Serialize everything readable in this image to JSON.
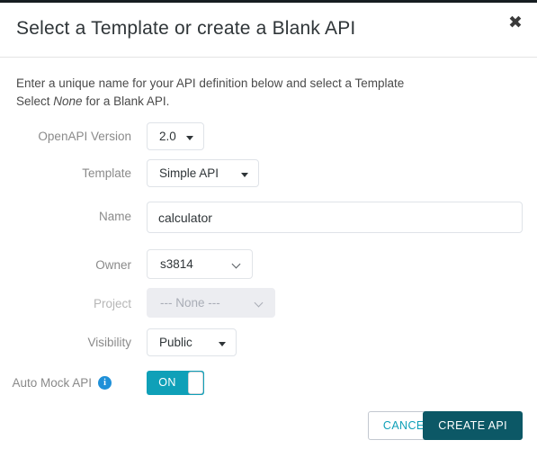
{
  "dialog": {
    "title": "Select a Template or create a Blank API",
    "close_icon": "close-icon",
    "intro_line1_before": "Enter a unique name for your API definition below and select a Template",
    "intro_line2_before": "Select ",
    "intro_italic": "None",
    "intro_line2_after": " for a Blank API."
  },
  "form": {
    "openapi_version": {
      "label": "OpenAPI Version",
      "value": "2.0",
      "caret_icon": "chevron-down-icon"
    },
    "template": {
      "label": "Template",
      "value": "Simple API",
      "caret_icon": "chevron-down-icon"
    },
    "name": {
      "label": "Name",
      "value": "calculator",
      "placeholder": ""
    },
    "owner": {
      "label": "Owner",
      "value": "s3814",
      "caret_icon": "chevron-down-icon"
    },
    "project": {
      "label": "Project",
      "value": "--- None ---",
      "disabled": true,
      "caret_icon": "chevron-down-icon"
    },
    "visibility": {
      "label": "Visibility",
      "value": "Public",
      "caret_icon": "chevron-down-icon"
    },
    "auto_mock_api": {
      "label": "Auto Mock API",
      "info_icon": "info-icon",
      "toggle_state": "ON"
    }
  },
  "footer": {
    "cancel_label": "CANCEL",
    "create_label": "CREATE API"
  },
  "colors": {
    "accent_teal": "#0fa0b8",
    "primary_dark_teal": "#0c5866",
    "info_blue": "#1f90d8",
    "label_grey": "#8a8a8a",
    "topbar_dark": "#161d21"
  }
}
